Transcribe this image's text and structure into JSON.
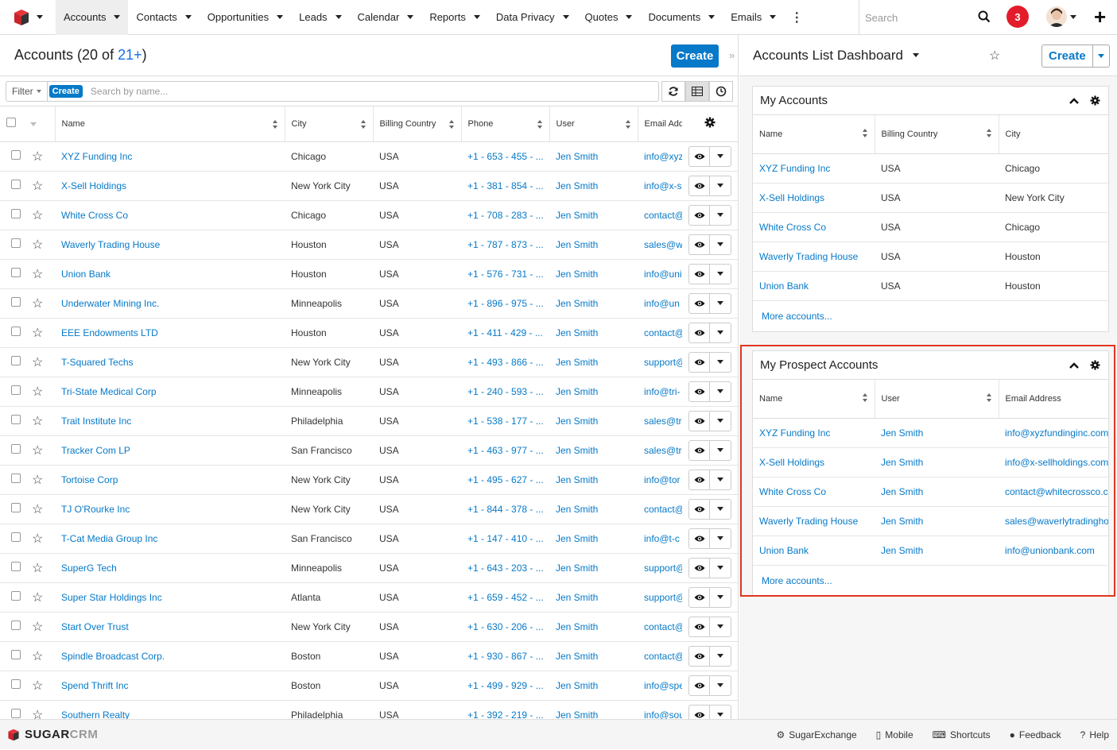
{
  "nav": {
    "tabs": [
      {
        "label": "Accounts",
        "active": true
      },
      {
        "label": "Contacts"
      },
      {
        "label": "Opportunities"
      },
      {
        "label": "Leads"
      },
      {
        "label": "Calendar"
      },
      {
        "label": "Reports"
      },
      {
        "label": "Data Privacy"
      },
      {
        "label": "Quotes"
      },
      {
        "label": "Documents"
      },
      {
        "label": "Emails"
      }
    ],
    "search_placeholder": "Search",
    "notification_count": "3"
  },
  "list": {
    "title": "Accounts (20 of ",
    "title_count": "21+",
    "title_close": ")",
    "create_label": "Create",
    "filter_label": "Filter",
    "filter_create_label": "Create",
    "search_placeholder": "Search by name...",
    "columns": [
      "Name",
      "City",
      "Billing Country",
      "Phone",
      "User",
      "Email Address"
    ],
    "rows": [
      {
        "name": "XYZ Funding Inc",
        "city": "Chicago",
        "country": "USA",
        "phone": "+1 - 653 - 455 - ...",
        "user": "Jen Smith",
        "email": "info@xyzfundinginc.com"
      },
      {
        "name": "X-Sell Holdings",
        "city": "New York City",
        "country": "USA",
        "phone": "+1 - 381 - 854 - ...",
        "user": "Jen Smith",
        "email": "info@x-sellholdings.com"
      },
      {
        "name": "White Cross Co",
        "city": "Chicago",
        "country": "USA",
        "phone": "+1 - 708 - 283 - ...",
        "user": "Jen Smith",
        "email": "contact@whitecrossco.com"
      },
      {
        "name": "Waverly Trading House",
        "city": "Houston",
        "country": "USA",
        "phone": "+1 - 787 - 873 - ...",
        "user": "Jen Smith",
        "email": "sales@waverlytradinghouse.com"
      },
      {
        "name": "Union Bank",
        "city": "Houston",
        "country": "USA",
        "phone": "+1 - 576 - 731 - ...",
        "user": "Jen Smith",
        "email": "info@unionbank.com"
      },
      {
        "name": "Underwater Mining Inc.",
        "city": "Minneapolis",
        "country": "USA",
        "phone": "+1 - 896 - 975 - ...",
        "user": "Jen Smith",
        "email": "info@un"
      },
      {
        "name": "EEE Endowments LTD",
        "city": "Houston",
        "country": "USA",
        "phone": "+1 - 411 - 429 - ...",
        "user": "Jen Smith",
        "email": "contact@"
      },
      {
        "name": "T-Squared Techs",
        "city": "New York City",
        "country": "USA",
        "phone": "+1 - 493 - 866 - ...",
        "user": "Jen Smith",
        "email": "support@"
      },
      {
        "name": "Tri-State Medical Corp",
        "city": "Minneapolis",
        "country": "USA",
        "phone": "+1 - 240 - 593 - ...",
        "user": "Jen Smith",
        "email": "info@tri-"
      },
      {
        "name": "Trait Institute Inc",
        "city": "Philadelphia",
        "country": "USA",
        "phone": "+1 - 538 - 177 - ...",
        "user": "Jen Smith",
        "email": "sales@tr"
      },
      {
        "name": "Tracker Com LP",
        "city": "San Francisco",
        "country": "USA",
        "phone": "+1 - 463 - 977 - ...",
        "user": "Jen Smith",
        "email": "sales@tr"
      },
      {
        "name": "Tortoise Corp",
        "city": "New York City",
        "country": "USA",
        "phone": "+1 - 495 - 627 - ...",
        "user": "Jen Smith",
        "email": "info@tor"
      },
      {
        "name": "TJ O'Rourke Inc",
        "city": "New York City",
        "country": "USA",
        "phone": "+1 - 844 - 378 - ...",
        "user": "Jen Smith",
        "email": "contact@"
      },
      {
        "name": "T-Cat Media Group Inc",
        "city": "San Francisco",
        "country": "USA",
        "phone": "+1 - 147 - 410 - ...",
        "user": "Jen Smith",
        "email": "info@t-c"
      },
      {
        "name": "SuperG Tech",
        "city": "Minneapolis",
        "country": "USA",
        "phone": "+1 - 643 - 203 - ...",
        "user": "Jen Smith",
        "email": "support@"
      },
      {
        "name": "Super Star Holdings Inc",
        "city": "Atlanta",
        "country": "USA",
        "phone": "+1 - 659 - 452 - ...",
        "user": "Jen Smith",
        "email": "support@"
      },
      {
        "name": "Start Over Trust",
        "city": "New York City",
        "country": "USA",
        "phone": "+1 - 630 - 206 - ...",
        "user": "Jen Smith",
        "email": "contact@"
      },
      {
        "name": "Spindle Broadcast Corp.",
        "city": "Boston",
        "country": "USA",
        "phone": "+1 - 930 - 867 - ...",
        "user": "Jen Smith",
        "email": "contact@"
      },
      {
        "name": "Spend Thrift Inc",
        "city": "Boston",
        "country": "USA",
        "phone": "+1 - 499 - 929 - ...",
        "user": "Jen Smith",
        "email": "info@spe"
      },
      {
        "name": "Southern Realty",
        "city": "Philadelphia",
        "country": "USA",
        "phone": "+1 - 392 - 219 - ...",
        "user": "Jen Smith",
        "email": "info@sou"
      }
    ]
  },
  "dashboard": {
    "title": "Accounts List Dashboard",
    "create_label": "Create",
    "my_accounts": {
      "title": "My Accounts",
      "columns": [
        "Name",
        "Billing Country",
        "City"
      ],
      "rows": [
        {
          "name": "XYZ Funding Inc",
          "country": "USA",
          "city": "Chicago"
        },
        {
          "name": "X-Sell Holdings",
          "country": "USA",
          "city": "New York City"
        },
        {
          "name": "White Cross Co",
          "country": "USA",
          "city": "Chicago"
        },
        {
          "name": "Waverly Trading House",
          "country": "USA",
          "city": "Houston"
        },
        {
          "name": "Union Bank",
          "country": "USA",
          "city": "Houston"
        }
      ],
      "more_label": "More accounts..."
    },
    "prospect_accounts": {
      "title": "My Prospect Accounts",
      "columns": [
        "Name",
        "User",
        "Email Address"
      ],
      "rows": [
        {
          "name": "XYZ Funding Inc",
          "user": "Jen Smith",
          "email": "info@xyzfundinginc.com"
        },
        {
          "name": "X-Sell Holdings",
          "user": "Jen Smith",
          "email": "info@x-sellholdings.com"
        },
        {
          "name": "White Cross Co",
          "user": "Jen Smith",
          "email": "contact@whitecrossco.com"
        },
        {
          "name": "Waverly Trading House",
          "user": "Jen Smith",
          "email": "sales@waverlytradinghouse.com"
        },
        {
          "name": "Union Bank",
          "user": "Jen Smith",
          "email": "info@unionbank.com"
        }
      ],
      "more_label": "More accounts..."
    }
  },
  "footer": {
    "brand": "SUGAR",
    "brand_suffix": "CRM",
    "links": [
      "SugarExchange",
      "Mobile",
      "Shortcuts",
      "Feedback",
      "Help"
    ]
  },
  "colors": {
    "accent": "#0679c8",
    "highlight": "#e0361f",
    "badge": "#e31c2c"
  }
}
